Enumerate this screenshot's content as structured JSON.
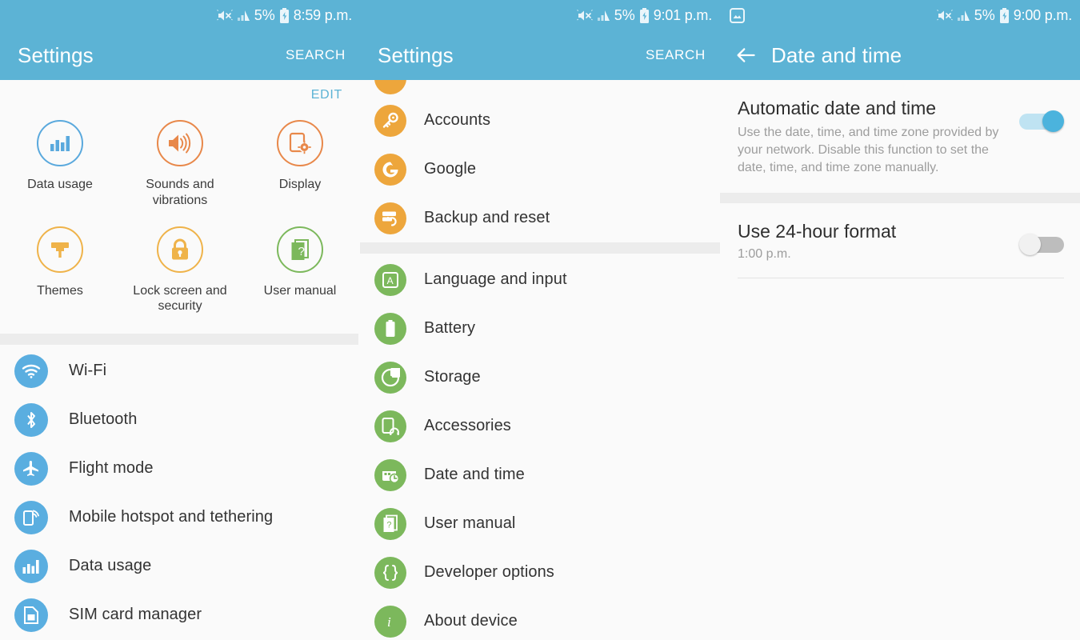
{
  "panels": {
    "left": {
      "statusbar": {
        "mute_icon": "mute-icon",
        "signal_icon": "signal-icon",
        "battery_pct": "5%",
        "battery_icon": "battery-charging-icon",
        "time": "8:59 p.m."
      },
      "appbar": {
        "title": "Settings",
        "action": "SEARCH"
      },
      "edit_label": "EDIT",
      "grid": [
        {
          "label": "Data usage",
          "icon": "bar-chart-icon",
          "color": "#5aa9dd"
        },
        {
          "label": "Sounds and vibrations",
          "icon": "speaker-icon",
          "color": "#e8884a"
        },
        {
          "label": "Display",
          "icon": "display-brightness-icon",
          "color": "#e8884a"
        },
        {
          "label": "Themes",
          "icon": "paint-brush-icon",
          "color": "#efb34a"
        },
        {
          "label": "Lock screen and security",
          "icon": "lock-icon",
          "color": "#efb34a"
        },
        {
          "label": "User manual",
          "icon": "manual-book-icon",
          "color": "#7cb85c"
        }
      ],
      "list": [
        {
          "label": "Wi-Fi",
          "icon": "wifi-icon",
          "color": "#5aaee0"
        },
        {
          "label": "Bluetooth",
          "icon": "bluetooth-icon",
          "color": "#5aaee0"
        },
        {
          "label": "Flight mode",
          "icon": "airplane-icon",
          "color": "#5aaee0"
        },
        {
          "label": "Mobile hotspot and tethering",
          "icon": "hotspot-icon",
          "color": "#5aaee0"
        },
        {
          "label": "Data usage",
          "icon": "bar-chart-icon",
          "color": "#5aaee0"
        },
        {
          "label": "SIM card manager",
          "icon": "sim-card-icon",
          "color": "#5aaee0"
        }
      ]
    },
    "middle": {
      "statusbar": {
        "mute_icon": "mute-icon",
        "signal_icon": "signal-icon",
        "battery_pct": "5%",
        "battery_icon": "battery-charging-icon",
        "time": "9:01 p.m."
      },
      "appbar": {
        "title": "Settings",
        "action": "SEARCH"
      },
      "list_group_1": [
        {
          "label": "Accounts",
          "icon": "key-icon",
          "color": "#eda63c"
        },
        {
          "label": "Google",
          "icon": "google-g-icon",
          "color": "#eda63c"
        },
        {
          "label": "Backup and reset",
          "icon": "backup-restore-icon",
          "color": "#eda63c"
        }
      ],
      "list_group_2": [
        {
          "label": "Language and input",
          "icon": "language-a-icon",
          "color": "#7cb85c"
        },
        {
          "label": "Battery",
          "icon": "battery-icon",
          "color": "#7cb85c"
        },
        {
          "label": "Storage",
          "icon": "storage-disc-icon",
          "color": "#7cb85c"
        },
        {
          "label": "Accessories",
          "icon": "accessories-headset-icon",
          "color": "#7cb85c"
        },
        {
          "label": "Date and time",
          "icon": "calendar-clock-icon",
          "color": "#7cb85c"
        },
        {
          "label": "User manual",
          "icon": "manual-book-icon",
          "color": "#7cb85c"
        },
        {
          "label": "Developer options",
          "icon": "braces-icon",
          "color": "#7cb85c"
        },
        {
          "label": "About device",
          "icon": "info-icon",
          "color": "#7cb85c"
        }
      ]
    },
    "right": {
      "statusbar": {
        "screenshot_icon": "screenshot-icon",
        "mute_icon": "mute-icon",
        "signal_icon": "signal-icon",
        "battery_pct": "5%",
        "battery_icon": "battery-charging-icon",
        "time": "9:00 p.m."
      },
      "appbar": {
        "title": "Date and time",
        "back_icon": "back-arrow-icon"
      },
      "settings": [
        {
          "title": "Automatic date and time",
          "subtitle": "Use the date, time, and time zone provided by your network. Disable this function to set the date, time, and time zone manually.",
          "toggle_state": "on"
        },
        {
          "title": "Use 24-hour format",
          "value": "1:00 p.m.",
          "toggle_state": "off"
        }
      ]
    }
  },
  "colors": {
    "header_blue": "#5cb3d5",
    "accent_blue": "#5aaee0",
    "orange": "#e8884a",
    "amber": "#efb34a",
    "green": "#7cb85c",
    "toggle_on": "#4bb3dd",
    "background": "#fafafa"
  }
}
